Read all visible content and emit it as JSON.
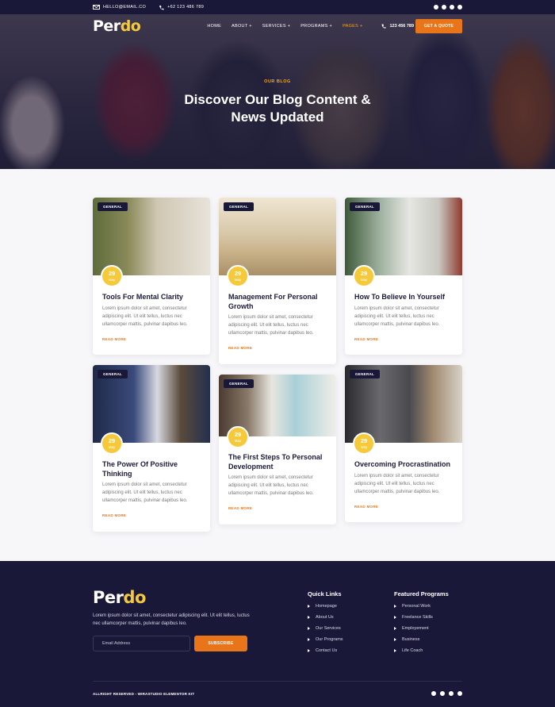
{
  "topbar": {
    "email": "HELLO@EMAIL.CO",
    "phone": "+62 123 486 789",
    "social": [
      "facebook-icon",
      "twitter-icon",
      "youtube-icon",
      "pinterest-icon"
    ]
  },
  "nav": {
    "logo_main": "Per",
    "logo_accent": "do",
    "menu": [
      "HOME",
      "ABOUT",
      "SERVICES",
      "PROGRAMS",
      "PAGES"
    ],
    "plus": "+",
    "phone": "123 456 789",
    "cta": "GET A QUOTE"
  },
  "hero": {
    "kicker": "OUR BLOG",
    "title_line1": "Discover Our Blog Content &",
    "title_line2": "News Updated"
  },
  "posts": [
    {
      "tag": "GENERAL",
      "day": "29",
      "month": "May",
      "title": "Tools For Mental Clarity",
      "excerpt": "Lorem ipsum dolor sit amet, consectetur adipiscing elit. Ut elit tellus, luctus nec ullamcorper mattis, pulvinar dapibus leo.",
      "more": "READ MORE"
    },
    {
      "tag": "GENERAL",
      "day": "29",
      "month": "May",
      "title": "Management For Personal Growth",
      "excerpt": "Lorem ipsum dolor sit amet, consectetur adipiscing elit. Ut elit tellus, luctus nec ullamcorper mattis, pulvinar dapibus leo.",
      "more": "READ MORE"
    },
    {
      "tag": "GENERAL",
      "day": "29",
      "month": "May",
      "title": "How To Believe In Yourself",
      "excerpt": "Lorem ipsum dolor sit amet, consectetur adipiscing elit. Ut elit tellus, luctus nec ullamcorper mattis, pulvinar dapibus leo.",
      "more": "READ MORE"
    },
    {
      "tag": "GENERAL",
      "day": "29",
      "month": "May",
      "title": "The Power Of Positive Thinking",
      "excerpt": "Lorem ipsum dolor sit amet, consectetur adipiscing elit. Ut elit tellus, luctus nec ullamcorper mattis, pulvinar dapibus leo.",
      "more": "READ MORE"
    },
    {
      "tag": "GENERAL",
      "day": "29",
      "month": "May",
      "title": "The First Steps To Personal Development",
      "excerpt": "Lorem ipsum dolor sit amet, consectetur adipiscing elit. Ut elit tellus, luctus nec ullamcorper mattis, pulvinar dapibus leo.",
      "more": "READ MORE"
    },
    {
      "tag": "GENERAL",
      "day": "29",
      "month": "May",
      "title": "Overcoming Procrastination",
      "excerpt": "Lorem ipsum dolor sit amet, consectetur adipiscing elit. Ut elit tellus, luctus nec ullamcorper mattis, pulvinar dapibus leo.",
      "more": "READ MORE"
    }
  ],
  "footer": {
    "logo_main": "Per",
    "logo_accent": "do",
    "description": "Lorem ipsum dolor sit amet, consectetur adipiscing elit. Ut elit tellus, luctus nec ullamcorper mattis, pulvinar dapibus leo.",
    "email_placeholder": "Email Address",
    "subscribe": "SUBSCRIBE",
    "quick_links_title": "Quick Links",
    "quick_links": [
      "Homepage",
      "About Us",
      "Our Services",
      "Our Programs",
      "Contact Us"
    ],
    "programs_title": "Featured Programs",
    "programs": [
      "Personal Work",
      "Freelance Skills",
      "Employement",
      "Business",
      "Life Coach"
    ],
    "copyright": "ALLRIGHT RESERVED - WIRASTUDIO ELEMENTOR KIT"
  },
  "colors": {
    "navy": "#1a1838",
    "orange": "#e8751a",
    "yellow": "#f5c93a"
  }
}
